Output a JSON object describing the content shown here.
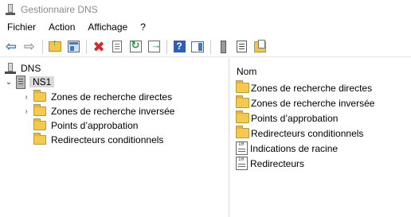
{
  "window": {
    "title": "Gestionnaire DNS"
  },
  "menu": {
    "items": [
      "Fichier",
      "Action",
      "Affichage",
      "?"
    ]
  },
  "toolbar": {
    "icons": [
      "back-arrow-icon",
      "forward-arrow-icon",
      "up-folder-icon",
      "show-hide-tree-icon",
      "delete-icon",
      "properties-icon",
      "refresh-icon",
      "export-list-icon",
      "help-icon",
      "action-pane-icon",
      "server-icon",
      "list-icon",
      "folder-doc-icon"
    ]
  },
  "tree": {
    "root": {
      "label": "DNS"
    },
    "server": {
      "label": "NS1"
    },
    "children": [
      {
        "label": "Zones de recherche directes",
        "expandable": true
      },
      {
        "label": "Zones de recherche inversée",
        "expandable": true
      },
      {
        "label": "Points d’approbation",
        "expandable": false
      },
      {
        "label": "Redirecteurs conditionnels",
        "expandable": false
      }
    ]
  },
  "details": {
    "column_header": "Nom",
    "items": [
      {
        "label": "Zones de recherche directes",
        "icon": "folder-icon"
      },
      {
        "label": "Zones de recherche inversée",
        "icon": "folder-icon"
      },
      {
        "label": "Points d’approbation",
        "icon": "folder-icon"
      },
      {
        "label": "Redirecteurs conditionnels",
        "icon": "folder-icon"
      },
      {
        "label": "Indications de racine",
        "icon": "record-icon"
      },
      {
        "label": "Redirecteurs",
        "icon": "record-icon"
      }
    ]
  },
  "colors": {
    "selection": "#d9d9d9",
    "folder": "#f4c94f",
    "delete": "#d8262c",
    "back": "#2a78c8"
  }
}
